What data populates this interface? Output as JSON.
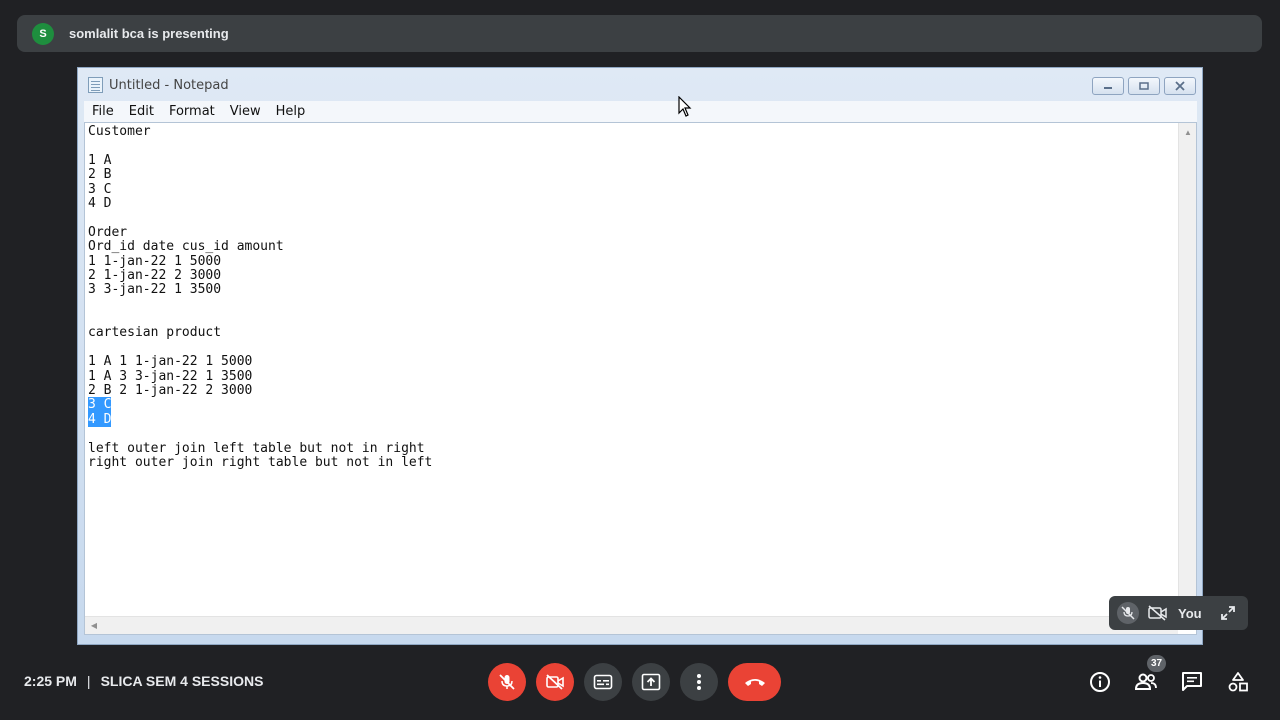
{
  "banner": {
    "avatar_letter": "S",
    "text": "somlalit bca is presenting"
  },
  "notepad": {
    "title": "Untitled - Notepad",
    "menu": [
      "File",
      "Edit",
      "Format",
      "View",
      "Help"
    ],
    "lines": [
      {
        "text": "Customer",
        "selected": false
      },
      {
        "text": "",
        "selected": false
      },
      {
        "text": "1 A",
        "selected": false
      },
      {
        "text": "2 B",
        "selected": false
      },
      {
        "text": "3 C",
        "selected": false
      },
      {
        "text": "4 D",
        "selected": false
      },
      {
        "text": "",
        "selected": false
      },
      {
        "text": "Order",
        "selected": false
      },
      {
        "text": "Ord_id date cus_id amount",
        "selected": false
      },
      {
        "text": "1 1-jan-22 1 5000",
        "selected": false
      },
      {
        "text": "2 1-jan-22 2 3000",
        "selected": false
      },
      {
        "text": "3 3-jan-22 1 3500",
        "selected": false
      },
      {
        "text": "",
        "selected": false
      },
      {
        "text": "",
        "selected": false
      },
      {
        "text": "cartesian product",
        "selected": false
      },
      {
        "text": "",
        "selected": false
      },
      {
        "text": "1 A 1 1-jan-22 1 5000",
        "selected": false
      },
      {
        "text": "1 A 3 3-jan-22 1 3500",
        "selected": false
      },
      {
        "text": "2 B 2 1-jan-22 2 3000",
        "selected": false
      },
      {
        "text": "3 C",
        "selected": true
      },
      {
        "text": "4 D",
        "selected": true
      },
      {
        "text": "",
        "selected": false
      },
      {
        "text": "left outer join left table but not in right",
        "selected": false
      },
      {
        "text": "right outer join right table but not in left",
        "selected": false
      }
    ]
  },
  "self_view": {
    "label": "You"
  },
  "meeting": {
    "time": "2:25 PM",
    "separator": "|",
    "name": "SLICA SEM 4 SESSIONS"
  },
  "participants_count": "37",
  "colors": {
    "background": "#202124",
    "control_dark": "#3c4043",
    "control_red": "#ea4335",
    "selection": "#3399ff"
  }
}
